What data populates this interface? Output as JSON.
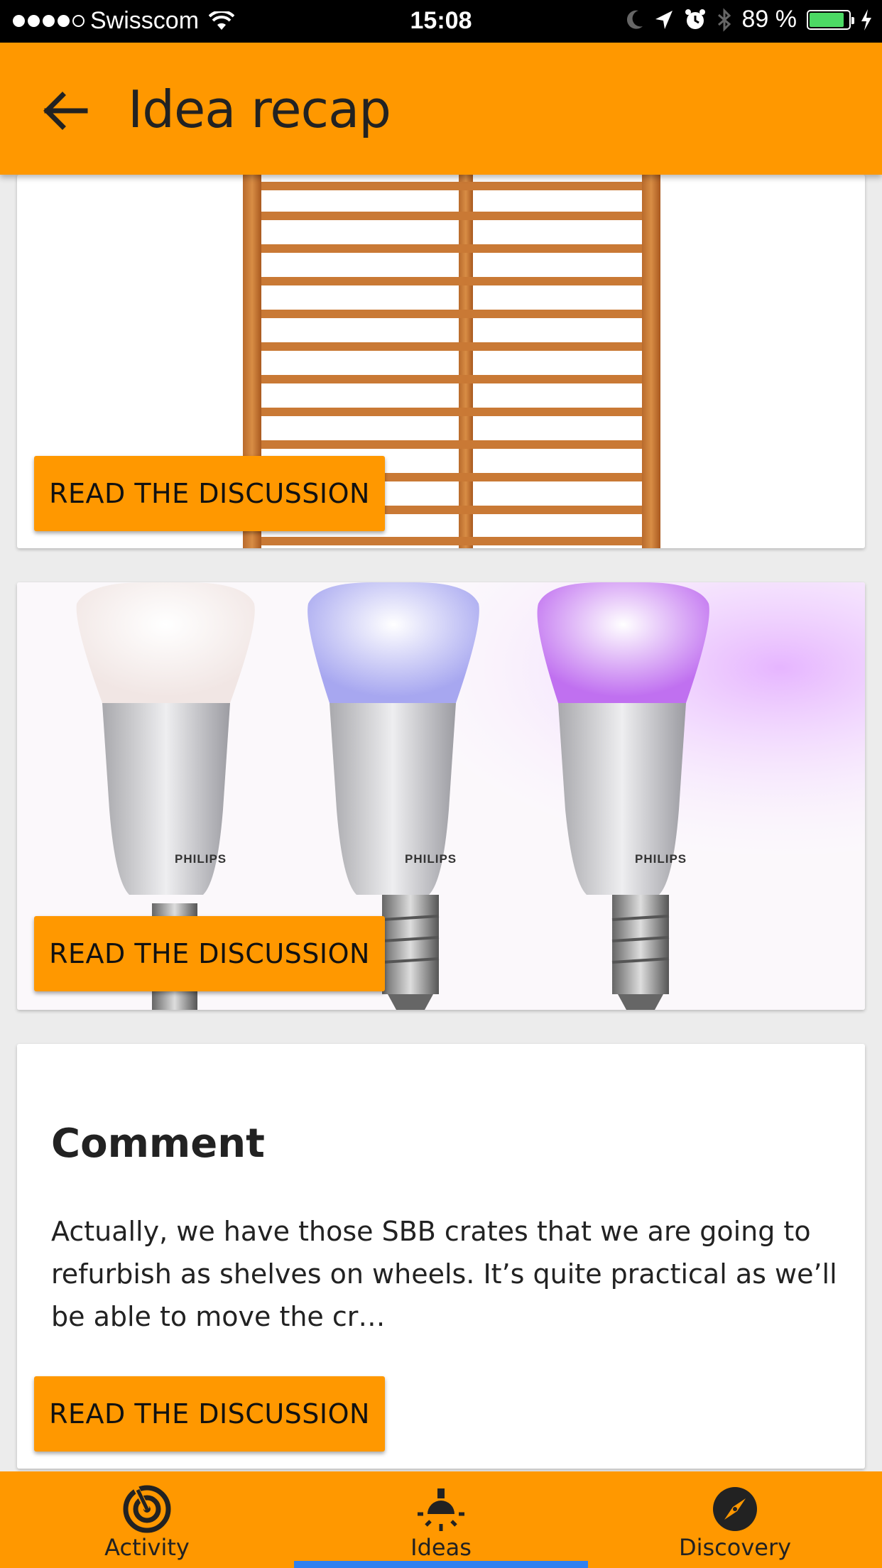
{
  "status_bar": {
    "carrier": "Swisscom",
    "time": "15:08",
    "battery": "89 %"
  },
  "app_bar": {
    "title": "Idea recap"
  },
  "cards": [
    {
      "button_label": "READ THE DISCUSSION"
    },
    {
      "button_label": "READ THE DISCUSSION",
      "bulb_brand": "PHILIPS"
    },
    {
      "title": "Comment",
      "body": "Actually, we have those SBB crates that we are going to refurbish as shelves on wheels. It’s quite practical as we’ll be able to move the cr…",
      "button_label": "READ THE DISCUSSION"
    }
  ],
  "bottom_nav": {
    "items": [
      {
        "label": "Activity",
        "icon": "activity-icon"
      },
      {
        "label": "Ideas",
        "icon": "lightbulb-icon"
      },
      {
        "label": "Discovery",
        "icon": "compass-icon"
      }
    ],
    "selected": "Ideas",
    "indicator_color": "#2f80f0"
  },
  "colors": {
    "accent": "#ff9800",
    "status_bar": "#000000",
    "battery": "#4cd964"
  }
}
